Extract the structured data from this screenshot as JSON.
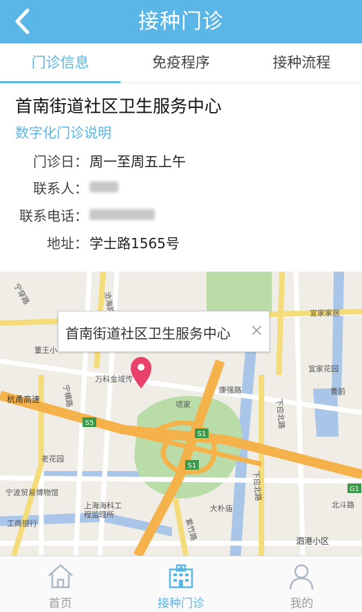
{
  "header": {
    "title": "接种门诊"
  },
  "tabs": [
    {
      "label": "门诊信息",
      "active": true
    },
    {
      "label": "免疫程序",
      "active": false
    },
    {
      "label": "接种流程",
      "active": false
    }
  ],
  "clinic": {
    "name": "首南街道社区卫生服务中心",
    "digital_link": "数字化门诊说明",
    "rows": [
      {
        "label": "门诊日：",
        "value": "周一至周五上午"
      },
      {
        "label": "联系人：",
        "value": ""
      },
      {
        "label": "联系电话：",
        "value": ""
      },
      {
        "label": "地址：",
        "value": "学士路1565号"
      }
    ]
  },
  "map": {
    "popup_title": "首南街道社区卫生服务中心",
    "close_symbol": "×",
    "labels": [
      "沧海路",
      "宁穿路",
      "宜家家居",
      "宜家花园",
      "董王小",
      "万科金域传",
      "康强路",
      "项家",
      "杭甬高速",
      "宁横路",
      "下应北路",
      "曹前",
      "S5",
      "S1",
      "S1",
      "老花园",
      "宁波贸易博物馆",
      "上海海科工",
      "程监理所",
      "大朴庙",
      "工商银行",
      "下应北路",
      "北斗路",
      "泗港小区",
      "紫竹路",
      "G1"
    ]
  },
  "nav": [
    {
      "label": "首页",
      "icon": "home-icon",
      "active": false
    },
    {
      "label": "接种门诊",
      "icon": "hospital-icon",
      "active": true
    },
    {
      "label": "我的",
      "icon": "user-icon",
      "active": false
    }
  ],
  "colors": {
    "accent": "#5ab6e6",
    "highway": "#f5b24a",
    "water": "#a9c6e8",
    "park": "#b9dca8"
  }
}
